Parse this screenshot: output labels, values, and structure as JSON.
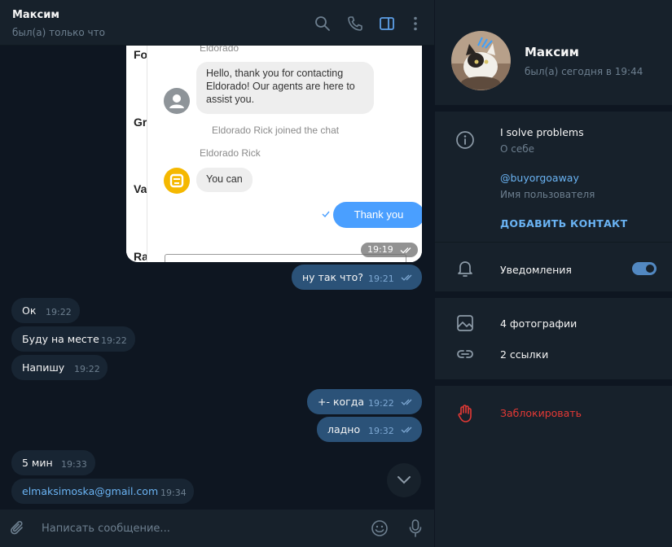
{
  "chat": {
    "title": "Максим",
    "status": "был(а) только что",
    "screenshot": {
      "side_letters": [
        "Fo",
        "Gr",
        "Va",
        "Ra"
      ],
      "agent_top": "Eldorado",
      "greeting": "Hello, thank you for contacting Eldorado! Our agents are here to assist you.",
      "joined": "Eldorado Rick joined the chat",
      "agent_name": "Eldorado Rick",
      "agent_message": "You can",
      "user_message": "Thank you",
      "time": "19:19"
    },
    "messages": [
      {
        "dir": "out",
        "text": "ну так что?",
        "time": "19:21"
      },
      {
        "dir": "in",
        "text": "Ок",
        "time": "19:22"
      },
      {
        "dir": "in",
        "text": "Буду на месте",
        "time": "19:22"
      },
      {
        "dir": "in",
        "text": "Напишу",
        "time": "19:22"
      },
      {
        "dir": "out",
        "text": "+- когда",
        "time": "19:22"
      },
      {
        "dir": "out",
        "text": "ладно",
        "time": "19:32"
      },
      {
        "dir": "in",
        "text": "5 мин",
        "time": "19:33"
      },
      {
        "dir": "in",
        "text": "elmaksimoska@gmail.com",
        "time": "19:34"
      }
    ],
    "input_placeholder": "Написать сообщение..."
  },
  "profile": {
    "name": "Максим",
    "last_seen": "был(а) сегодня в 19:44",
    "bio": "I solve problems",
    "bio_label": "О себе",
    "username": "@buyorgoaway",
    "username_label": "Имя пользователя",
    "add_contact": "ДОБАВИТЬ КОНТАКТ",
    "notifications": "Уведомления",
    "notifications_on": true,
    "photos": "4 фотографии",
    "links": "2 ссылки",
    "block": "Заблокировать"
  },
  "colors": {
    "background": "#0e1621",
    "panel": "#17212b",
    "bubble_in": "#182533",
    "bubble_out": "#2b5278",
    "accent": "#6ab3f3",
    "danger": "#e53935",
    "widget_blue": "#4a9fff"
  },
  "icons": [
    "search-icon",
    "phone-icon",
    "sidebar-toggle-icon",
    "more-icon",
    "info-icon",
    "bell-icon",
    "photo-icon",
    "link-icon",
    "hand-icon",
    "attach-icon",
    "emoji-icon",
    "mic-icon",
    "chevron-down-icon"
  ]
}
